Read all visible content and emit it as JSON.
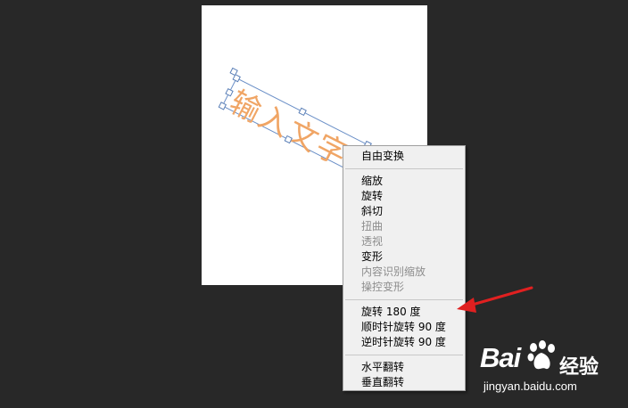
{
  "canvas": {
    "text": "输入文字"
  },
  "context_menu": {
    "groups": [
      [
        {
          "label": "自由变换",
          "enabled": true
        }
      ],
      [
        {
          "label": "缩放",
          "enabled": true
        },
        {
          "label": "旋转",
          "enabled": true
        },
        {
          "label": "斜切",
          "enabled": true
        },
        {
          "label": "扭曲",
          "enabled": false
        },
        {
          "label": "透视",
          "enabled": false
        },
        {
          "label": "变形",
          "enabled": true
        },
        {
          "label": "内容识别缩放",
          "enabled": false
        },
        {
          "label": "操控变形",
          "enabled": false
        }
      ],
      [
        {
          "label": "旋转 180 度",
          "enabled": true
        },
        {
          "label": "顺时针旋转 90 度",
          "enabled": true
        },
        {
          "label": "逆时针旋转 90 度",
          "enabled": true
        }
      ],
      [
        {
          "label": "水平翻转",
          "enabled": true
        },
        {
          "label": "垂直翻转",
          "enabled": true
        }
      ]
    ]
  },
  "annotation": {
    "arrow_color": "#e02020",
    "points_to": "旋转 180 度"
  },
  "watermark": {
    "logo": "Bai",
    "logo_suffix": "经验",
    "url": "jingyan.baidu.com"
  },
  "colors": {
    "background": "#282828",
    "canvas": "#ffffff",
    "text": "#f0a565",
    "handle_border": "#5a7fb7",
    "menu_bg": "#f0f0f0",
    "disabled_text": "#8d8d8d"
  }
}
